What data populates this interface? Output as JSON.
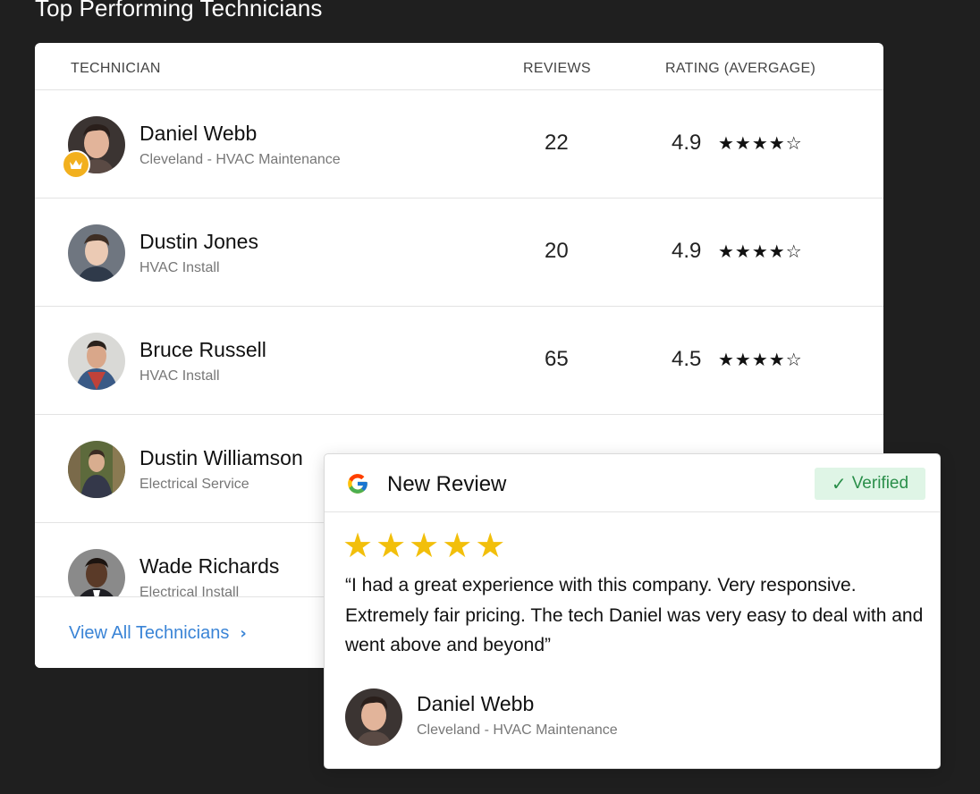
{
  "page": {
    "title": "Top Performing Technicians"
  },
  "table": {
    "headers": {
      "technician": "TECHNICIAN",
      "reviews": "REVIEWS",
      "rating": "RATING (AVERGAGE)"
    },
    "rows": [
      {
        "name": "Daniel Webb",
        "sub": "Cleveland - HVAC Maintenance",
        "reviews": "22",
        "rating": "4.9",
        "stars": "★★★★☆",
        "top": true
      },
      {
        "name": "Dustin Jones",
        "sub": "HVAC Install",
        "reviews": "20",
        "rating": "4.9",
        "stars": "★★★★☆"
      },
      {
        "name": "Bruce Russell",
        "sub": "HVAC Install",
        "reviews": "65",
        "rating": "4.5",
        "stars": "★★★★☆"
      },
      {
        "name": "Dustin Williamson",
        "sub": "Electrical Service",
        "reviews": "",
        "rating": "",
        "stars": ""
      },
      {
        "name": "Wade Richards",
        "sub": "Electrical Install",
        "reviews": "",
        "rating": "",
        "stars": ""
      }
    ],
    "footer": {
      "link": "View All Technicians",
      "chevron": "›"
    }
  },
  "review": {
    "title": "New Review",
    "verified": "Verified",
    "check": "✓",
    "stars": "★★★★★",
    "star_count": 5,
    "quote": "“I had a great experience with this company. Very responsive. Extremely fair pricing. The tech Daniel was very easy to deal with and went above and beyond”",
    "reviewer_name": "Daniel Webb",
    "reviewer_sub": "Cleveland - HVAC Maintenance"
  },
  "colors": {
    "accent": "#3a84d6",
    "star_gold": "#f2bf0b",
    "badge": "#f2b01e",
    "verified_bg": "#dff5e6",
    "verified_text": "#2a8f4a"
  },
  "icons": [
    "crown-icon",
    "google-icon",
    "check-icon",
    "chevron-right-icon"
  ]
}
